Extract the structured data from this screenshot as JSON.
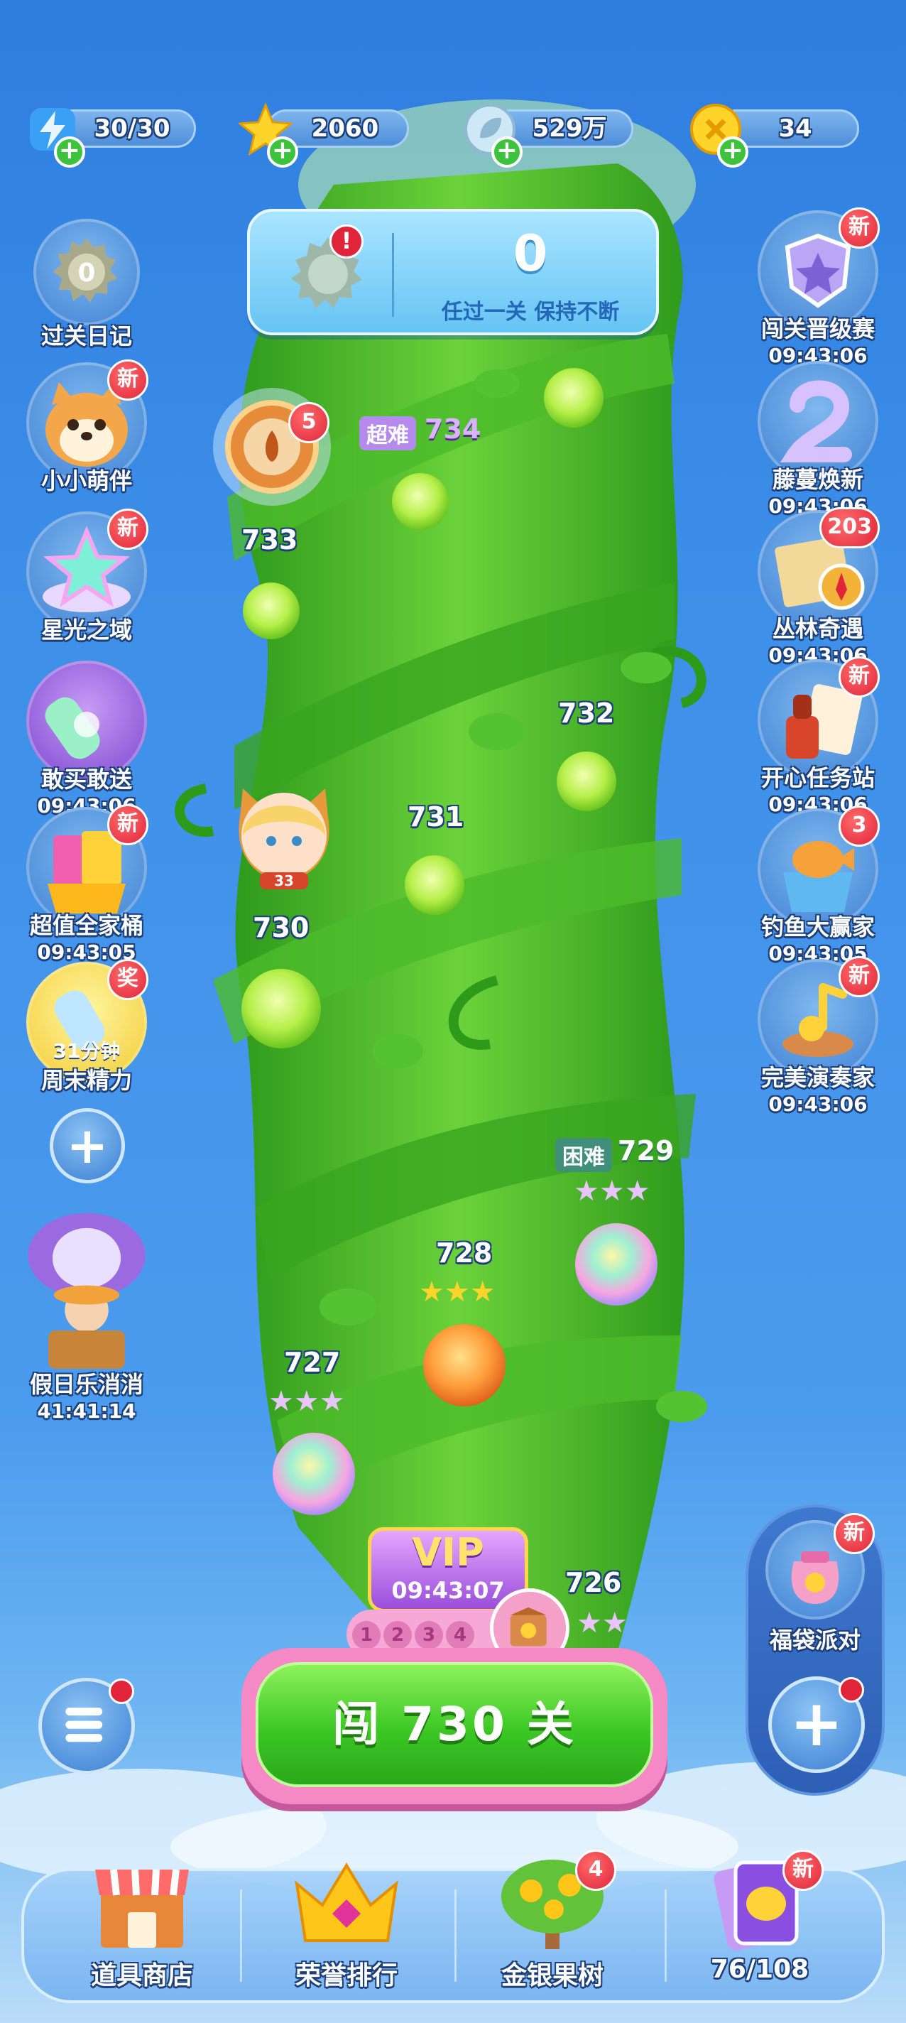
{
  "resources": {
    "energy": "30/30",
    "stars": "2060",
    "leaves": "529万",
    "coins": "34"
  },
  "streak": {
    "count": "0",
    "subtitle": "任过一关  保持不断"
  },
  "left_side": [
    {
      "label": "过关日记",
      "time": "",
      "badge": ""
    },
    {
      "label": "小小萌伴",
      "time": "",
      "badge": "新"
    },
    {
      "label": "星光之域",
      "time": "",
      "badge": "新"
    },
    {
      "label": "敢买敢送",
      "time": "09:43:06",
      "badge": ""
    },
    {
      "label": "超值全家桶",
      "time": "09:43:05",
      "badge": "新"
    },
    {
      "label": "周末精力",
      "time": "",
      "badge": "奖",
      "inner": "31分钟"
    },
    {
      "label": "假日乐消消",
      "time": "41:41:14",
      "badge": ""
    }
  ],
  "right_side": [
    {
      "label": "闯关晋级赛",
      "time": "09:43:06",
      "badge": "新"
    },
    {
      "label": "藤蔓焕新",
      "time": "09:43:06",
      "badge": ""
    },
    {
      "label": "丛林奇遇",
      "time": "09:43:06",
      "badge": "203"
    },
    {
      "label": "开心任务站",
      "time": "09:43:06",
      "badge": "新"
    },
    {
      "label": "钓鱼大赢家",
      "time": "09:43:05",
      "badge": "3"
    },
    {
      "label": "完美演奏家",
      "time": "09:43:06",
      "badge": "新"
    }
  ],
  "spin_wheel_badge": "5",
  "avatar_level": "33",
  "levels": {
    "l726": "726",
    "l727": "727",
    "l728": "728",
    "l729": "729",
    "l730": "730",
    "l731": "731",
    "l732": "732",
    "l733": "733",
    "l734": "734"
  },
  "tags": {
    "super_hard": "超难",
    "hard": "困难"
  },
  "vip": {
    "label": "VIP",
    "time": "09:43:07"
  },
  "steps": [
    "1",
    "2",
    "3",
    "4"
  ],
  "play_button": "闯 730 关",
  "lucky_bag": {
    "label": "福袋派对",
    "badge": "新"
  },
  "bottom_nav": [
    {
      "label": "道具商店",
      "badge": ""
    },
    {
      "label": "荣誉排行",
      "badge": ""
    },
    {
      "label": "金银果树",
      "badge": "4"
    },
    {
      "label": "76/108",
      "badge": "新"
    }
  ]
}
